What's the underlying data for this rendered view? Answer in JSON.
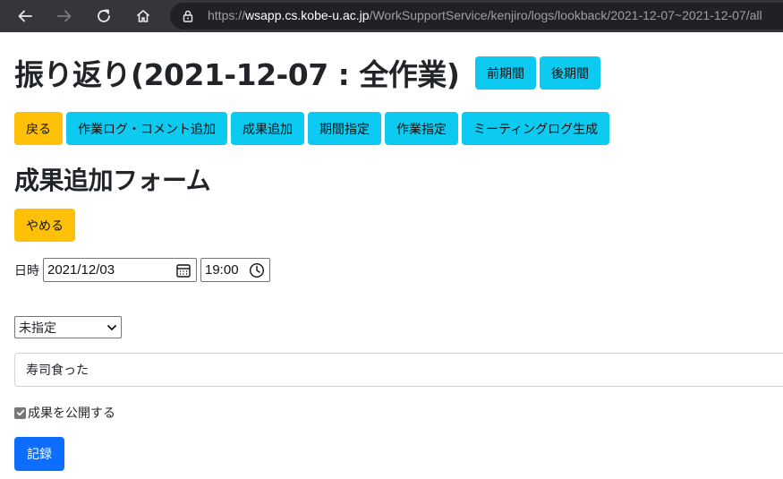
{
  "browser": {
    "url_scheme": "https://",
    "url_host": "wsapp.cs.kobe-u.ac.jp",
    "url_path": "/WorkSupportService/kenjiro/logs/lookback/2021-12-07~2021-12-07/all",
    "icons": [
      "back-arrow-icon",
      "forward-arrow-icon",
      "reload-icon",
      "home-icon",
      "lock-icon"
    ]
  },
  "page": {
    "title": "振り返り(2021-12-07 : 全作業)",
    "period_buttons": [
      "前期間",
      "後期間"
    ],
    "actions": {
      "back": "戻る",
      "add_log_comment": "作業ログ・コメント追加",
      "add_result": "成果追加",
      "period": "期間指定",
      "task": "作業指定",
      "meeting_log": "ミーティングログ生成"
    }
  },
  "form": {
    "title": "成果追加フォーム",
    "cancel": "やめる",
    "datetime_label": "日時",
    "date_value": "2021/12/03",
    "time_value": "19:00",
    "select_value": "未指定",
    "text_value": "寿司食った",
    "publish_label": "成果を公開する",
    "publish_checked": true,
    "submit": "記録"
  },
  "colors": {
    "toolbar": "#35363a",
    "info": "#0dcaf0",
    "warning": "#ffc107",
    "primary": "#0d6efd"
  }
}
